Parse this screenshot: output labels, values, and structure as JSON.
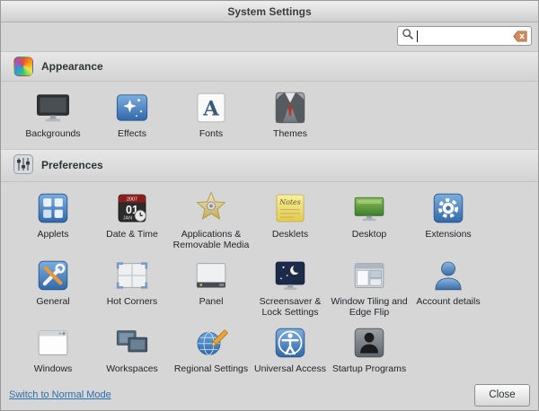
{
  "titlebar": {
    "title": "System Settings"
  },
  "search": {
    "value": "",
    "placeholder": "",
    "icons": {
      "left": "search-icon",
      "right": "clear-icon"
    }
  },
  "sections": {
    "appearance": {
      "label": "Appearance",
      "icon": "appearance-swirl-icon",
      "items": [
        {
          "label": "Backgrounds",
          "icon": "backgrounds-icon"
        },
        {
          "label": "Effects",
          "icon": "effects-icon"
        },
        {
          "label": "Fonts",
          "icon": "fonts-icon"
        },
        {
          "label": "Themes",
          "icon": "themes-icon"
        }
      ]
    },
    "preferences": {
      "label": "Preferences",
      "icon": "preferences-sliders-icon",
      "items": [
        {
          "label": "Applets",
          "icon": "applets-icon"
        },
        {
          "label": "Date & Time",
          "icon": "date-time-icon"
        },
        {
          "label": "Applications & Removable Media",
          "icon": "applications-removable-media-icon"
        },
        {
          "label": "Desklets",
          "icon": "desklets-icon"
        },
        {
          "label": "Desktop",
          "icon": "desktop-icon"
        },
        {
          "label": "Extensions",
          "icon": "extensions-icon"
        },
        {
          "label": "General",
          "icon": "general-icon"
        },
        {
          "label": "Hot Corners",
          "icon": "hot-corners-icon"
        },
        {
          "label": "Panel",
          "icon": "panel-icon"
        },
        {
          "label": "Screensaver & Lock Settings",
          "icon": "screensaver-icon"
        },
        {
          "label": "Window Tiling and Edge Flip",
          "icon": "window-tiling-icon"
        },
        {
          "label": "Account details",
          "icon": "account-details-icon"
        },
        {
          "label": "Windows",
          "icon": "windows-icon"
        },
        {
          "label": "Workspaces",
          "icon": "workspaces-icon"
        },
        {
          "label": "Regional Settings",
          "icon": "regional-settings-icon"
        },
        {
          "label": "Universal Access",
          "icon": "universal-access-icon"
        },
        {
          "label": "Startup Programs",
          "icon": "startup-programs-icon"
        }
      ]
    }
  },
  "footer": {
    "mode_link": "Switch to Normal Mode",
    "close_label": "Close"
  },
  "colors": {
    "icon_blue": "#3268a8",
    "link_blue": "#2a6db0",
    "window_grey": "#d6d6d6"
  }
}
